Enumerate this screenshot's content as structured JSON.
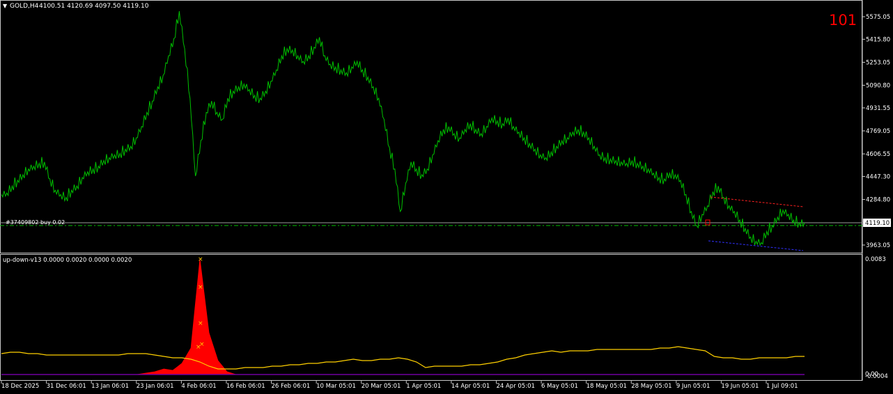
{
  "colors": {
    "background": "#000000",
    "axis": "#c8c8c8",
    "price_line": "#00c000",
    "price_level_line": "#00c000",
    "counter": "#ff0000",
    "trend_upper": "#ff2020",
    "trend_lower": "#3030ff",
    "oscillator_line": "#ffd000",
    "histogram": "#ff0000",
    "histogram_low": "#7000a0",
    "marker": "#ffd000"
  },
  "header": {
    "symbol_label": "GOLD,H4",
    "ohlc": "4100.51 4120.69 4097.50 4119.10",
    "counter": "101"
  },
  "order_label": "#37409802 buy 0.02",
  "price_tag": "4119.10",
  "indicator": {
    "label": "up-down-v13 0.0000 0.0020 0.0000 0.0020"
  },
  "chart_data": [
    {
      "type": "line",
      "name": "GOLD,H4",
      "y_ticks": [
        "5575.05",
        "5415.80",
        "5253.05",
        "5090.80",
        "4931.55",
        "4769.05",
        "4606.55",
        "4447.30",
        "4284.80",
        "3963.05"
      ],
      "ylim": [
        3870,
        5640
      ],
      "x_labels": [
        "18 Dec 2025",
        "31 Dec 06:01",
        "13 Jan 06:01",
        "23 Jan 06:01",
        "4 Feb 06:01",
        "16 Feb 06:01",
        "26 Feb 06:01",
        "10 Mar 05:01",
        "20 Mar 05:01",
        "1 Apr 05:01",
        "14 Apr 05:01",
        "24 Apr 05:01",
        "6 May 05:01",
        "18 May 05:01",
        "28 May 05:01",
        "9 Jun 05:01",
        "19 Jun 05:01",
        "1 Jul 09:01"
      ],
      "x": [
        0,
        1,
        2,
        3,
        4,
        5,
        6,
        7,
        8,
        9,
        10,
        11,
        12,
        13,
        14,
        15,
        16,
        17,
        18,
        19,
        20,
        21,
        22,
        23,
        24,
        25,
        26,
        27,
        28,
        29,
        30,
        31,
        32,
        33,
        34,
        35,
        36,
        37,
        38,
        39,
        40,
        41,
        42,
        43,
        44,
        45,
        46,
        47,
        48,
        49,
        50,
        51,
        52,
        53,
        54,
        55,
        56,
        57,
        58,
        59,
        60,
        61,
        62,
        63,
        64,
        65,
        66,
        67,
        68,
        69,
        70,
        71,
        72,
        73,
        74,
        75,
        76,
        77,
        78,
        79,
        80,
        81,
        82,
        83,
        84,
        85,
        86,
        87,
        88,
        89,
        90,
        91,
        92,
        93,
        94,
        95,
        96,
        97,
        98,
        99,
        100,
        101,
        102,
        103,
        104,
        105,
        106,
        107,
        108,
        109,
        110,
        111,
        112,
        113,
        114,
        115,
        116,
        117,
        118,
        119,
        120,
        121,
        122,
        123,
        124,
        125,
        126,
        127,
        128,
        129,
        130,
        131,
        132,
        133,
        134,
        135,
        136,
        137,
        138,
        139,
        140,
        141,
        142,
        143,
        144,
        145,
        146,
        147,
        148,
        149
      ],
      "close": [
        4320,
        4330,
        4380,
        4420,
        4460,
        4500,
        4520,
        4540,
        4550,
        4430,
        4350,
        4320,
        4300,
        4350,
        4380,
        4440,
        4480,
        4500,
        4520,
        4560,
        4580,
        4600,
        4610,
        4640,
        4660,
        4720,
        4800,
        4900,
        4980,
        5080,
        5160,
        5300,
        5420,
        5640,
        5350,
        5000,
        4450,
        4700,
        4900,
        4980,
        4900,
        4850,
        5000,
        5050,
        5080,
        5100,
        5060,
        5020,
        5000,
        5050,
        5120,
        5200,
        5300,
        5350,
        5340,
        5300,
        5260,
        5300,
        5360,
        5430,
        5300,
        5240,
        5220,
        5200,
        5180,
        5220,
        5260,
        5200,
        5150,
        5080,
        5000,
        4850,
        4650,
        4500,
        4200,
        4400,
        4550,
        4500,
        4460,
        4500,
        4600,
        4700,
        4780,
        4800,
        4750,
        4720,
        4780,
        4820,
        4780,
        4750,
        4800,
        4860,
        4840,
        4820,
        4860,
        4800,
        4760,
        4720,
        4680,
        4640,
        4600,
        4580,
        4620,
        4660,
        4700,
        4720,
        4760,
        4780,
        4760,
        4720,
        4660,
        4600,
        4580,
        4570,
        4560,
        4550,
        4540,
        4560,
        4540,
        4520,
        4500,
        4470,
        4440,
        4430,
        4470,
        4460,
        4420,
        4320,
        4200,
        4100,
        4180,
        4240,
        4340,
        4380,
        4300,
        4240,
        4200,
        4140,
        4080,
        4020,
        3990,
        3980,
        4060,
        4100,
        4160,
        4210,
        4180,
        4140,
        4120,
        4119.1
      ]
    },
    {
      "type": "line",
      "name": "up-down-v13",
      "y_ticks": [
        "0.0083",
        "0.00",
        "-0.0004"
      ],
      "ylim": [
        -0.0004,
        0.0083
      ],
      "series": [
        {
          "role": "line",
          "values": [
            0.0015,
            0.0016,
            0.0016,
            0.0015,
            0.0015,
            0.0014,
            0.0014,
            0.0014,
            0.0014,
            0.0014,
            0.0014,
            0.0014,
            0.0014,
            0.0014,
            0.0015,
            0.0015,
            0.0015,
            0.0014,
            0.0013,
            0.0012,
            0.0012,
            0.0011,
            0.0009,
            0.0006,
            0.0004,
            0.0004,
            0.0004,
            0.0005,
            0.0005,
            0.0005,
            0.0006,
            0.0006,
            0.0007,
            0.0007,
            0.0008,
            0.0008,
            0.0009,
            0.0009,
            0.001,
            0.0011,
            0.001,
            0.001,
            0.0011,
            0.0011,
            0.0012,
            0.0011,
            0.0009,
            0.0005,
            0.0006,
            0.0006,
            0.0006,
            0.0006,
            0.0007,
            0.0007,
            0.0008,
            0.0009,
            0.0011,
            0.0012,
            0.0014,
            0.0015,
            0.0016,
            0.0017,
            0.0016,
            0.0017,
            0.0017,
            0.0017,
            0.0018,
            0.0018,
            0.0018,
            0.0018,
            0.0018,
            0.0018,
            0.0018,
            0.0019,
            0.0019,
            0.002,
            0.0019,
            0.0018,
            0.0017,
            0.0013,
            0.0012,
            0.0012,
            0.0011,
            0.0011,
            0.0012,
            0.0012,
            0.0012,
            0.0012,
            0.0013,
            0.0013
          ]
        },
        {
          "role": "histogram_spike",
          "values": [
            0,
            0,
            0,
            0,
            0,
            0,
            0,
            0,
            0,
            0,
            0,
            0,
            0,
            0,
            0,
            0,
            0.0001,
            0.0002,
            0.0004,
            0.0003,
            0.0008,
            0.0019,
            0.0083,
            0.003,
            0.001,
            0.0002,
            0,
            0,
            0,
            0,
            0,
            0,
            0,
            0,
            0,
            0,
            0,
            0,
            0,
            0,
            0,
            0,
            0,
            0,
            0,
            0,
            0,
            0,
            0,
            0,
            0,
            0,
            0,
            0,
            0,
            0,
            0,
            0,
            0,
            0,
            0,
            0,
            0,
            0,
            0,
            0,
            0,
            0,
            0,
            0,
            0,
            0,
            0,
            0,
            0,
            0,
            0,
            0,
            0,
            0,
            0,
            0,
            0,
            0,
            0,
            0,
            0,
            0,
            0,
            0
          ]
        }
      ],
      "markers": [
        0.0083,
        0.0063,
        0.0037,
        0.002,
        0.0022
      ]
    }
  ]
}
